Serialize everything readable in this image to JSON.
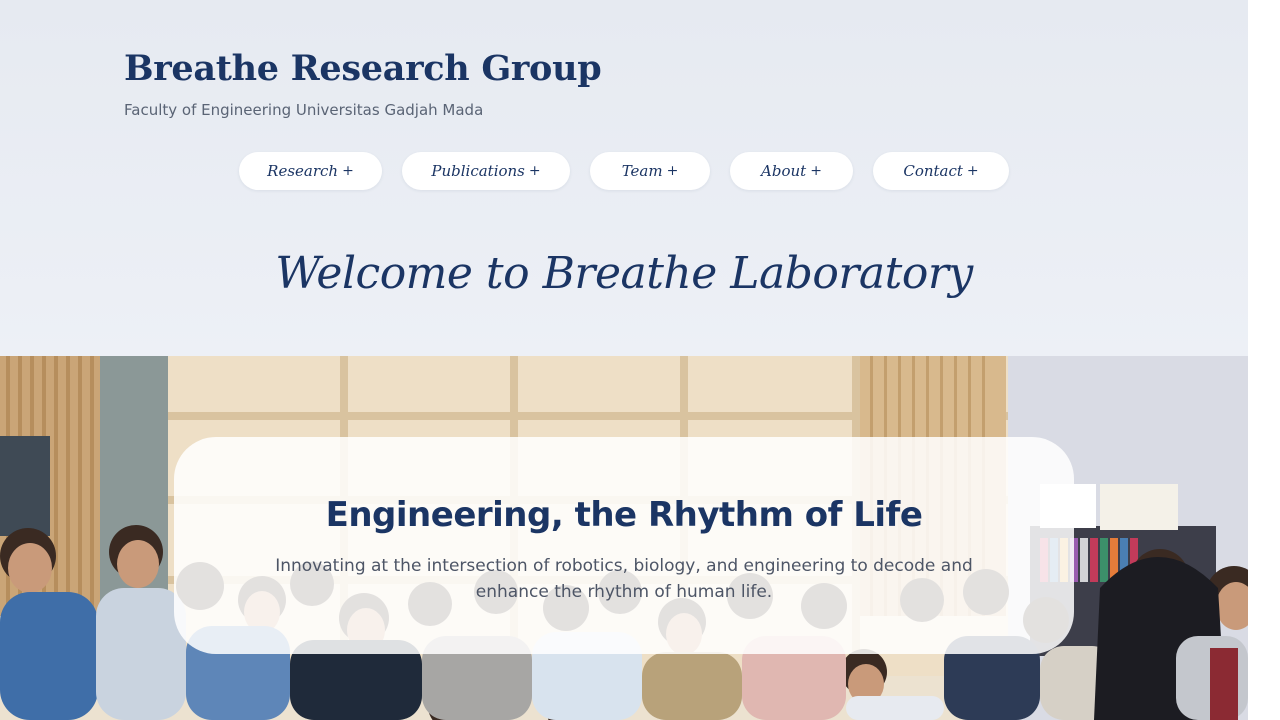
{
  "site": {
    "title": "Breathe Research Group",
    "subtitle": "Faculty of Engineering Universitas Gadjah Mada"
  },
  "nav": {
    "items": [
      {
        "label": "Research",
        "suffix": "+"
      },
      {
        "label": "Publications",
        "suffix": "+"
      },
      {
        "label": "Team",
        "suffix": "+"
      },
      {
        "label": "About",
        "suffix": "+"
      },
      {
        "label": "Contact",
        "suffix": "+"
      }
    ]
  },
  "welcome": {
    "heading": "Welcome to Breathe Laboratory"
  },
  "hero": {
    "tagline": "Engineering, the Rhythm of Life",
    "description": "Innovating at the intersection of robotics, biology, and engineering to decode and enhance the rhythm of human life."
  },
  "colors": {
    "brand": "#1b3564",
    "header_bg": "#e6eaf1",
    "muted_text": "#5a6475",
    "pill_bg": "#ffffff"
  }
}
